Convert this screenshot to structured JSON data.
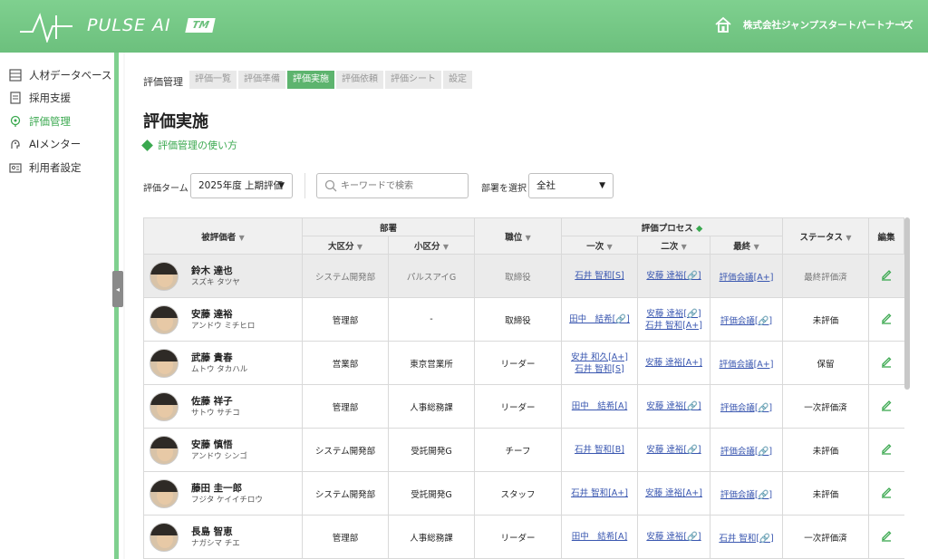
{
  "app": {
    "logo_text": "PULSE AI",
    "logo_tm": "TM",
    "company": "株式会社ジャンプスタートパートナーズ",
    "company_chevron": "∨"
  },
  "sidebar": {
    "items": [
      {
        "label": "人材データベース",
        "icon": "database-icon"
      },
      {
        "label": "採用支援",
        "icon": "document-icon"
      },
      {
        "label": "評価管理",
        "icon": "badge-icon",
        "active": true
      },
      {
        "label": "AIメンター",
        "icon": "ai-head-icon"
      },
      {
        "label": "利用者設定",
        "icon": "user-settings-icon"
      }
    ],
    "collapse_glyph": "◂"
  },
  "breadcrumb": {
    "label": "評価管理",
    "tabs": [
      "評価一覧",
      "評価準備",
      "評価実施",
      "評価依頼",
      "評価シート",
      "設定"
    ],
    "active_tab": "評価実施"
  },
  "page": {
    "title": "評価実施",
    "help_link": "評価管理の使い方"
  },
  "filters": {
    "term_label": "評価ターム",
    "term_value": "2025年度 上期評価",
    "search_placeholder": "キーワードで検索",
    "dept_label": "部署を選択",
    "dept_value": "全社",
    "caret": "▼"
  },
  "table": {
    "headers": {
      "employee": "被評価者",
      "department": "部署",
      "dept_major": "大区分",
      "dept_minor": "小区分",
      "position": "職位",
      "process": "評価プロセス",
      "first": "一次",
      "second": "二次",
      "final": "最終",
      "status": "ステータス",
      "edit": "編集",
      "sort": "▼",
      "process_mark": "◆"
    },
    "rows": [
      {
        "name": "鈴木 達也",
        "kana": "スズキ タツヤ",
        "major": "システム開発部",
        "minor": "パルスアイG",
        "position": "取締役",
        "first": [
          "石井 智和[S]"
        ],
        "second": [
          "安藤 達裕[🔗]"
        ],
        "final": "評価会議[A+]",
        "status": "最終評価済",
        "selected": true
      },
      {
        "name": "安藤 達裕",
        "kana": "アンドウ ミチヒロ",
        "major": "管理部",
        "minor": "-",
        "position": "取締役",
        "first": [
          "田中　結希[🔗]"
        ],
        "second": [
          "安藤 達裕[🔗]",
          "石井 智和[A+]"
        ],
        "final": "評価会議[🔗]",
        "status": "未評価"
      },
      {
        "name": "武藤 貴春",
        "kana": "ムトウ タカハル",
        "major": "営業部",
        "minor": "東京営業所",
        "position": "リーダー",
        "first": [
          "安井 和久[A+]",
          "石井 智和[S]"
        ],
        "second": [
          "安藤 達裕[A+]"
        ],
        "final": "評価会議[A+]",
        "status": "保留"
      },
      {
        "name": "佐藤 祥子",
        "kana": "サトウ サチコ",
        "major": "管理部",
        "minor": "人事総務課",
        "position": "リーダー",
        "first": [
          "田中　結希[A]"
        ],
        "second": [
          "安藤 達裕[🔗]"
        ],
        "final": "評価会議[🔗]",
        "status": "一次評価済"
      },
      {
        "name": "安藤 慎悟",
        "kana": "アンドウ シンゴ",
        "major": "システム開発部",
        "minor": "受託開発G",
        "position": "チーフ",
        "first": [
          "石井 智和[B]"
        ],
        "second": [
          "安藤 達裕[🔗]"
        ],
        "final": "評価会議[🔗]",
        "status": "未評価"
      },
      {
        "name": "藤田 圭一郎",
        "kana": "フジタ ケイイチロウ",
        "major": "システム開発部",
        "minor": "受託開発G",
        "position": "スタッフ",
        "first": [
          "石井 智和[A+]"
        ],
        "second": [
          "安藤 達裕[A+]"
        ],
        "final": "評価会議[🔗]",
        "status": "未評価"
      },
      {
        "name": "長島 智恵",
        "kana": "ナガシマ チエ",
        "major": "管理部",
        "minor": "人事総務課",
        "position": "リーダー",
        "first": [
          "田中　結希[A]"
        ],
        "second": [
          "安藤 達裕[🔗]"
        ],
        "final": "石井 智和[🔗]",
        "status": "一次評価済"
      }
    ]
  }
}
